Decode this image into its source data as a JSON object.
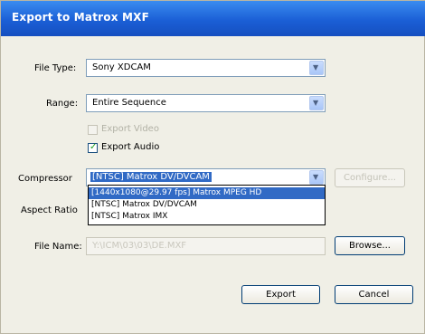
{
  "window": {
    "title": "Export to Matrox MXF"
  },
  "file_type": {
    "label": "File Type:",
    "value": "Sony XDCAM"
  },
  "range": {
    "label": "Range:",
    "value": "Entire Sequence"
  },
  "export_video": {
    "label": "Export Video",
    "checked": false,
    "enabled": false
  },
  "export_audio": {
    "label": "Export Audio",
    "checked": true
  },
  "compressor": {
    "label": "Compressor",
    "value": "[NTSC] Matrox DV/DVCAM",
    "options": [
      "[1440x1080@29.97 fps] Matrox MPEG HD",
      "[NTSC] Matrox DV/DVCAM",
      "[NTSC] Matrox IMX"
    ],
    "highlighted_index": 0
  },
  "configure_button": {
    "label": "Configure..."
  },
  "aspect_ratio": {
    "label": "Aspect Ratio"
  },
  "file_name": {
    "label": "File Name:",
    "value": "Y:\\ICM\\03\\03\\DE.MXF"
  },
  "browse_button": {
    "label": "Browse..."
  },
  "export_button": {
    "label": "Export"
  },
  "cancel_button": {
    "label": "Cancel"
  },
  "colors": {
    "titlebar": "#1b5fd6",
    "selection": "#316ac5",
    "check": "#21a121"
  }
}
